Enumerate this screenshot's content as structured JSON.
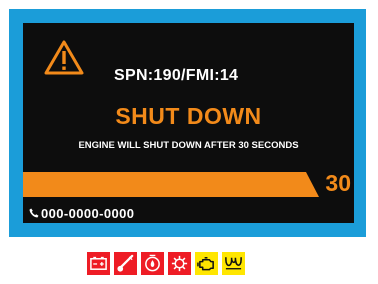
{
  "display": {
    "fault_code": "SPN:190/FMI:14",
    "headline": "SHUT DOWN",
    "message": "ENGINE WILL SHUT DOWN AFTER 30 SECONDS",
    "countdown": "30",
    "phone": "000-0000-0000"
  },
  "colors": {
    "frame": "#1b9dd9",
    "screen": "#0d0d0d",
    "accent": "#f28a1a",
    "text": "#ffffff",
    "lamp_red": "#ee1c25",
    "lamp_yellow": "#ffe600"
  },
  "status_lamps": [
    {
      "icon": "battery-icon",
      "color": "red"
    },
    {
      "icon": "coolant-temperature-icon",
      "color": "red"
    },
    {
      "icon": "oil-pressure-icon",
      "color": "red"
    },
    {
      "icon": "fuel-filter-icon",
      "color": "red"
    },
    {
      "icon": "check-engine-icon",
      "color": "yellow"
    },
    {
      "icon": "glow-plug-icon",
      "color": "yellow"
    }
  ]
}
